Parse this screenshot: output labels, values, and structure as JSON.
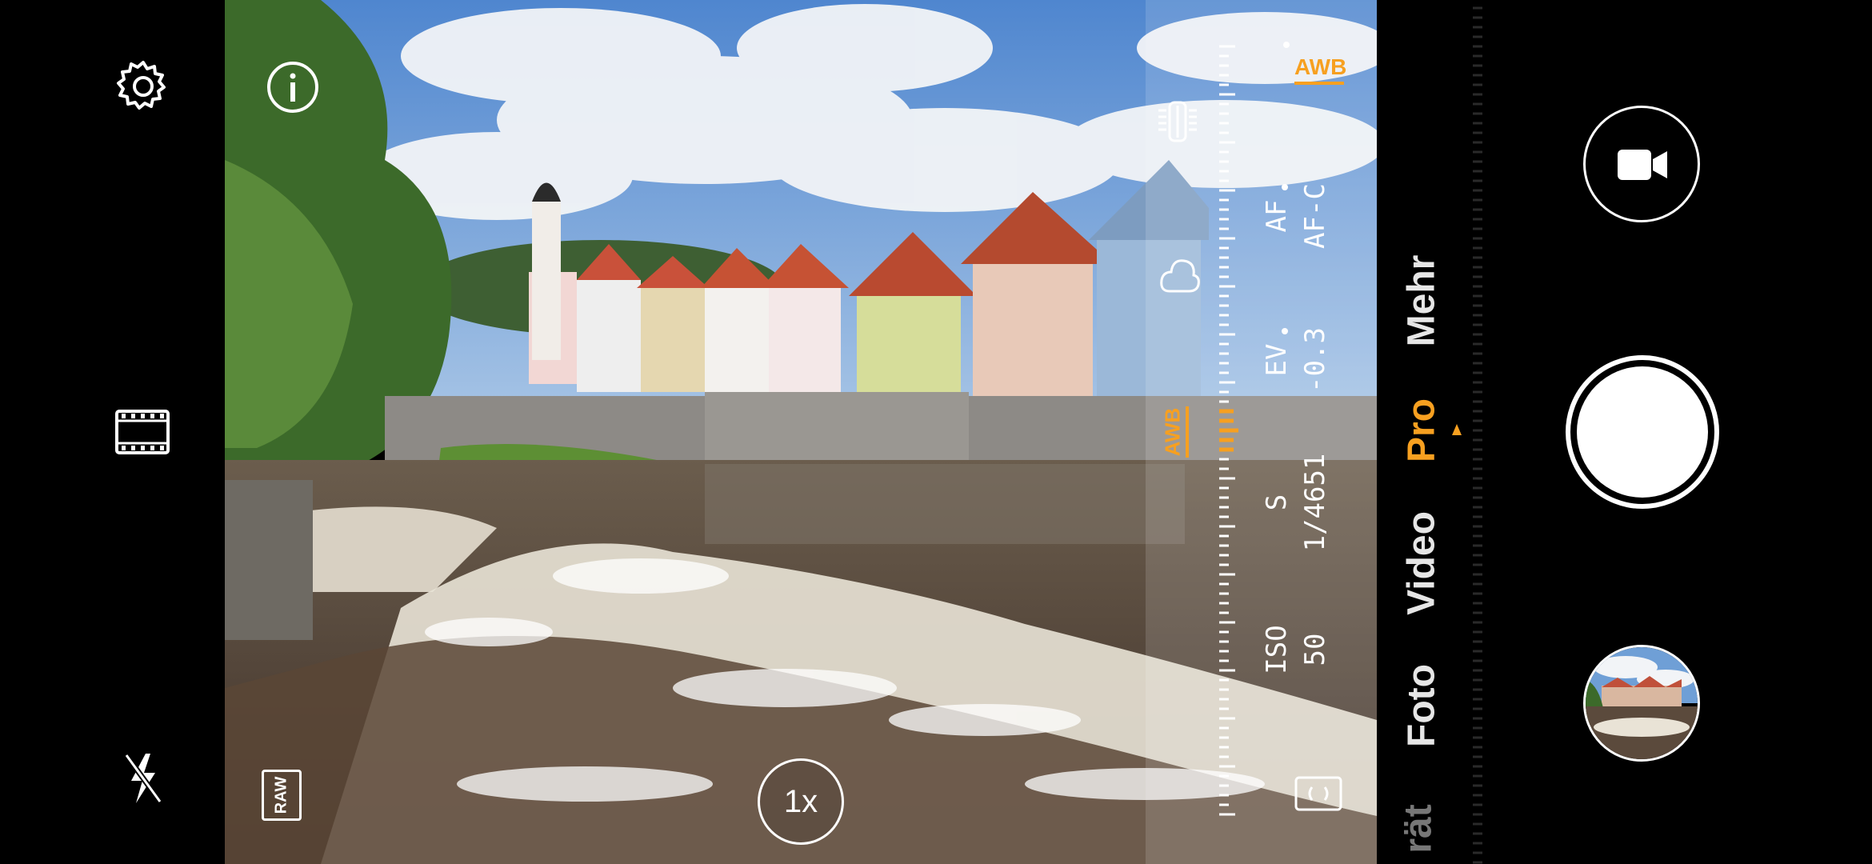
{
  "left_rail": {
    "settings_icon": "gear-icon",
    "film_icon": "film-strip-icon",
    "flash_icon": "flash-off-icon"
  },
  "viewfinder": {
    "info_icon": "info-icon",
    "raw_label": "RAW",
    "zoom_label": "1x",
    "colors": {
      "sky": "#6f9fd6",
      "water": "#5b4a3c"
    }
  },
  "pro_panel": {
    "awb_current": "AWB",
    "awb_mode": "AWB",
    "af_label": "AF",
    "af_value": "AF-C",
    "ev_label": "EV",
    "ev_value": "-0.3",
    "shutter_label": "S",
    "shutter_value": "1/4651",
    "iso_label": "ISO",
    "iso_value": "50",
    "accent": "#f7a020"
  },
  "modes": {
    "items": [
      "rät",
      "Foto",
      "Video",
      "Pro",
      "Mehr"
    ],
    "active": "Pro"
  },
  "right_panel": {
    "video_icon": "video-camera-icon",
    "shutter": "shutter-button",
    "thumbnail": "gallery-thumbnail"
  }
}
